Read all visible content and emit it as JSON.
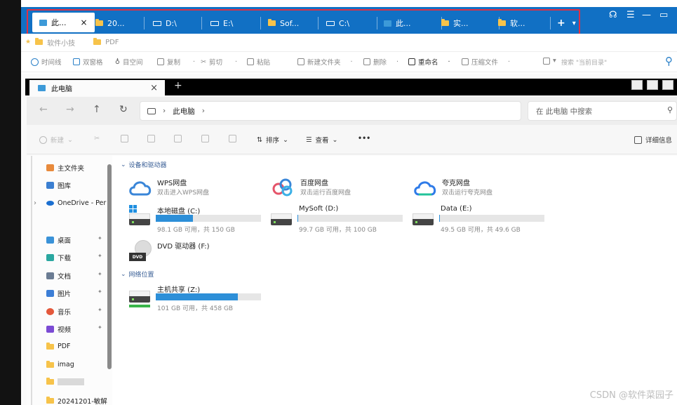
{
  "outer_tabs": [
    {
      "label": "此...",
      "kind": "pc",
      "close": "×"
    },
    {
      "label": "20...",
      "kind": "folder"
    },
    {
      "label": "D:\\",
      "kind": "drive"
    },
    {
      "label": "E:\\",
      "kind": "drive"
    },
    {
      "label": "Sof...",
      "kind": "folder"
    },
    {
      "label": "C:\\",
      "kind": "drive"
    },
    {
      "label": "此...",
      "kind": "pc"
    },
    {
      "label": "实...",
      "kind": "folder"
    },
    {
      "label": "软...",
      "kind": "folder"
    }
  ],
  "add_tab": "+",
  "add_tab_menu": "▾",
  "window_controls": {
    "headset": "☊",
    "menu": "☰",
    "minimize": "—",
    "maximize": "▭"
  },
  "bookmarks": [
    {
      "label": "软件小技"
    },
    {
      "label": "PDF"
    }
  ],
  "outer_toolbar": {
    "items": [
      "时间线",
      "双窗格",
      "目空间",
      "复制",
      "剪切",
      "粘贴",
      "新建文件夹",
      "删除",
      "重命名",
      "压缩文件"
    ],
    "search_placeholder": "搜索 \"当前目录\""
  },
  "inner": {
    "tab_label": "此电脑",
    "tab_close": "×",
    "new_tab": "+",
    "address_parts": [
      "此电脑"
    ],
    "search_placeholder": "在 此电脑 中搜索",
    "commands": {
      "new": "新建",
      "sort": "排序",
      "view": "查看",
      "more": "•••",
      "details": "详细信息"
    }
  },
  "sidebar": {
    "items": [
      {
        "label": "主文件夹",
        "color": "#e88a3c"
      },
      {
        "label": "图库",
        "color": "#3b7fd1"
      },
      {
        "label": "OneDrive - Per",
        "color": "#1b6fd0"
      },
      {
        "label": "桌面",
        "color": "#3a92d8",
        "pinned": true
      },
      {
        "label": "下载",
        "color": "#2aa7a0",
        "pinned": true
      },
      {
        "label": "文档",
        "color": "#6b7c93",
        "pinned": true
      },
      {
        "label": "图片",
        "color": "#3c7ed6",
        "pinned": true
      },
      {
        "label": "音乐",
        "color": "#e4583b",
        "pinned": true
      },
      {
        "label": "视频",
        "color": "#7b4bd4",
        "pinned": true
      },
      {
        "label": "PDF",
        "color": "#f7c34a"
      },
      {
        "label": "imag",
        "color": "#f7c34a"
      },
      {
        "label": "",
        "color": "#dddddd"
      },
      {
        "label": "20241201-敏解",
        "color": "#f7c34a"
      }
    ],
    "pin_glyph": "📌"
  },
  "sections": {
    "devices": "设备和驱动器",
    "network": "网络位置"
  },
  "clouds": [
    {
      "name": "WPS网盘",
      "desc": "双击进入WPS网盘",
      "color": "#3a86d8"
    },
    {
      "name": "百度网盘",
      "desc": "双击运行百度网盘",
      "color": "#e5546a"
    },
    {
      "name": "夸克网盘",
      "desc": "双击运行夸克网盘",
      "color": "#2f7be8"
    }
  ],
  "drives": [
    {
      "name": "本地磁盘 (C:)",
      "size": "98.1 GB 可用，共 150 GB",
      "used_fraction": 0.35
    },
    {
      "name": "MySoft (D:)",
      "size": "99.7 GB 可用，共 100 GB",
      "used_fraction": 0.003
    },
    {
      "name": "Data (E:)",
      "size": "49.5 GB 可用，共 49.6 GB",
      "used_fraction": 0.003
    }
  ],
  "dvd": {
    "name": "DVD 驱动器 (F:)",
    "badge": "DVD"
  },
  "network_drive": {
    "name": "主机共享 (Z:)",
    "size": "101 GB 可用，共 458 GB",
    "used_fraction": 0.78
  },
  "watermark": "CSDN @软件菜园子",
  "colors": {
    "titlebar": "#1170c4",
    "highlight": "#e03044",
    "bar_fill": "#2d8fd8"
  }
}
